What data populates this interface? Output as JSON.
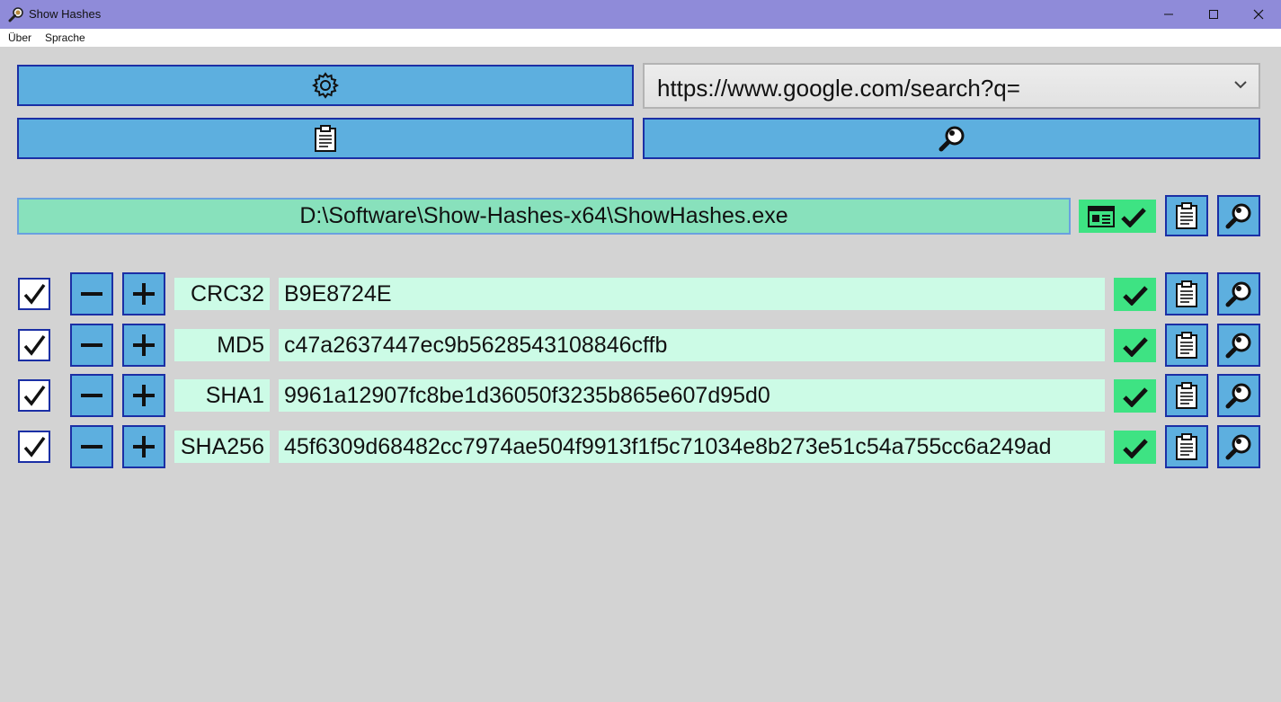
{
  "window": {
    "title": "Show Hashes",
    "controls": [
      "minimize-icon",
      "maximize-icon",
      "close-icon"
    ]
  },
  "menu": {
    "items": [
      {
        "label": "Über"
      },
      {
        "label": "Sprache"
      }
    ]
  },
  "toolbar": {
    "settings_icon": "gear-icon",
    "clipboard_icon": "clipboard-icon",
    "search_icon": "magnifier-icon",
    "search_engine": {
      "selected": "https://www.google.com/search?q=",
      "icon": "chevron-down-icon"
    }
  },
  "file": {
    "path": "D:\\Software\\Show-Hashes-x64\\ShowHashes.exe",
    "status_icons": [
      "window-icon",
      "checkmark-icon"
    ]
  },
  "hashes": [
    {
      "name": "CRC32",
      "value": "B9E8724E",
      "enabled": true
    },
    {
      "name": "MD5",
      "value": "c47a2637447ec9b5628543108846cffb",
      "enabled": true
    },
    {
      "name": "SHA1",
      "value": "9961a12907fc8be1d36050f3235b865e607d95d0",
      "enabled": true
    },
    {
      "name": "SHA256",
      "value": "45f6309d68482cc7974ae504f9913f1f5c71034e8b273e51c54a755cc6a249ad",
      "enabled": true
    }
  ],
  "colors": {
    "titlebar": "#8f8bd9",
    "button_fill": "#5dafdf",
    "button_border": "#1b2fa5",
    "file_field": "#88e1bc",
    "hash_field": "#ccfbe6",
    "status_green": "#3ee383",
    "background": "#d3d3d3"
  }
}
